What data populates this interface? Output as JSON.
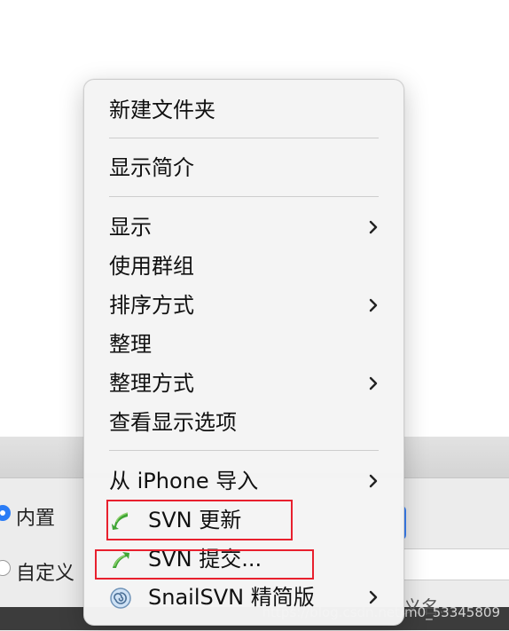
{
  "background": {
    "radio_builtin_label": "内置",
    "radio_custom_label": "自定义",
    "partial_text": "义名...",
    "watermark": "https://blog.csdn.net/m0_53345809"
  },
  "menu": {
    "items": [
      {
        "label": "新建文件夹",
        "submenu": false
      },
      {
        "label": "显示简介",
        "submenu": false
      },
      {
        "label": "显示",
        "submenu": true
      },
      {
        "label": "使用群组",
        "submenu": false
      },
      {
        "label": "排序方式",
        "submenu": true
      },
      {
        "label": "整理",
        "submenu": false
      },
      {
        "label": "整理方式",
        "submenu": true
      },
      {
        "label": "查看显示选项",
        "submenu": false
      },
      {
        "label": "从 iPhone 导入",
        "submenu": true
      },
      {
        "label": "SVN 更新",
        "submenu": false,
        "icon": "svn-update-icon"
      },
      {
        "label": "SVN 提交...",
        "submenu": false,
        "icon": "svn-commit-icon"
      },
      {
        "label": "SnailSVN 精简版",
        "submenu": true,
        "icon": "snailsvn-icon"
      }
    ]
  },
  "colors": {
    "highlight_border": "#e8202e",
    "accent_blue": "#2a7cf6",
    "svn_green": "#3fa535"
  }
}
